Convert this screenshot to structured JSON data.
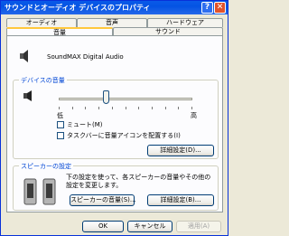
{
  "window": {
    "title": "サウンドとオーディオ デバイスのプロパティ"
  },
  "title_buttons": {
    "help": "?",
    "close": "✕"
  },
  "tabs": {
    "row1": [
      "オーディオ",
      "音声",
      "ハードウェア"
    ],
    "row2": [
      "音量",
      "サウンド"
    ],
    "active": "音量"
  },
  "device": {
    "name": "SoundMAX Digital Audio",
    "icon": "speaker-icon"
  },
  "volume": {
    "group_title": "デバイスの音量",
    "low_label": "低",
    "high_label": "高",
    "level": 0.35,
    "mute_label": "ミュート(M)",
    "mute_checked": false,
    "taskbar_label": "タスクバーに音量アイコンを配置する(I)",
    "taskbar_checked": false,
    "advanced_button": "詳細設定(D)..."
  },
  "speakers": {
    "group_title": "スピーカーの設定",
    "description": "下の設定を使って、各スピーカーの音量やその他の設定を変更します。",
    "volume_button": "スピーカーの音量(S)...",
    "advanced_button": "詳細設定(B)..."
  },
  "footer": {
    "ok": "OK",
    "cancel": "キャンセル",
    "apply": "適用(A)"
  },
  "colors": {
    "titlebar": "#0453e3",
    "group_title": "#0046d5",
    "tab_highlight": "#ffc83c"
  }
}
